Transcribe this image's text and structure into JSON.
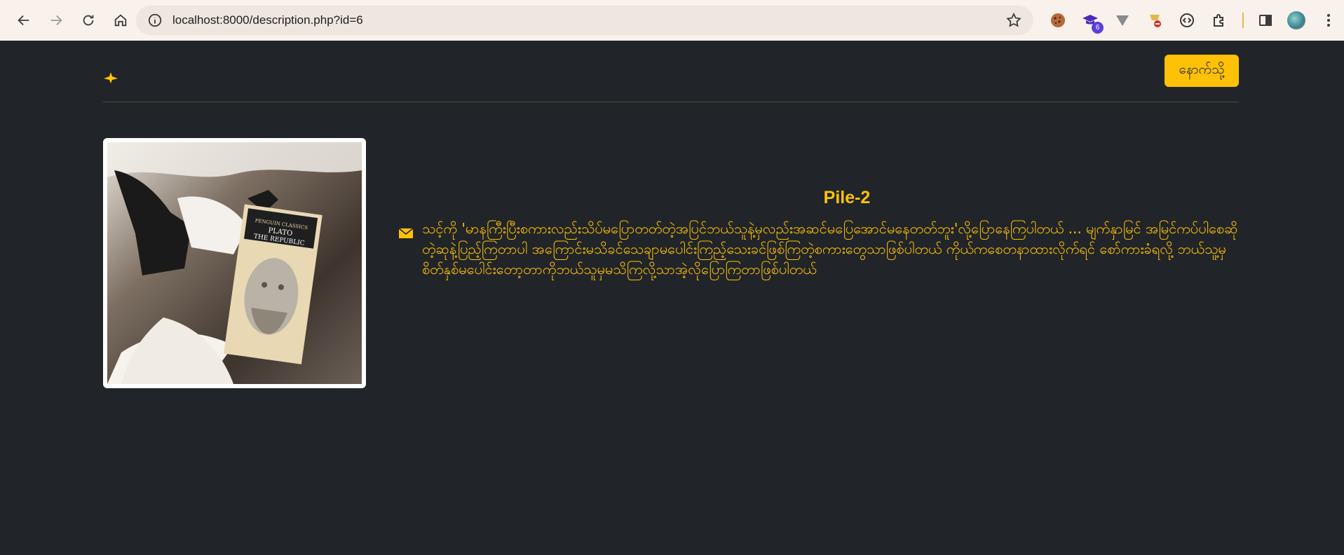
{
  "browser": {
    "url": "localhost:8000/description.php?id=6",
    "extensions": [
      {
        "name": "cookie-icon"
      },
      {
        "name": "graduation-cap-icon",
        "badge": "6"
      },
      {
        "name": "triangle-icon"
      },
      {
        "name": "blocked-extension-icon"
      },
      {
        "name": "code-icon"
      },
      {
        "name": "puzzle-icon"
      }
    ]
  },
  "header": {
    "back_label": "နောက်သို့"
  },
  "item": {
    "title": "Pile-2",
    "description": "သင့်ကို 'မာနကြီးပြီးစကားလည်းသိပ်မပြောတတ်တဲ့အပြင်ဘယ်သူနဲ့မှလည်းအဆင်မပြေအောင်မနေတတ်ဘူး'လို့ပြောနေကြပါတယ် ... မျက်နှာမြင် အမြင်ကပ်ပါစေဆိုတဲ့ဆုနဲ့ပြည့်ကြတာပါ အကြောင်းမသိခင်သေချာမပေါင်းကြည့်သေးခင်ဖြစ်ကြတဲ့စကားတွေသာဖြစ်ပါတယ် ကိုယ်ကစေတနာထားလိုက်ရင် စော်ကားခံရလို့ ဘယ်သူ့မှစိတ်နှစ်မပေါင်းတော့တာကိုဘယ်သူမှမသိကြလို့သာအဲ့လိုပြောကြတာဖြစ်ပါတယ်",
    "book_cover_top": "PENGUIN CLASSICS",
    "book_author": "PLATO",
    "book_title": "THE REPUBLIC"
  },
  "colors": {
    "accent": "#ffc107",
    "background": "#212529"
  }
}
